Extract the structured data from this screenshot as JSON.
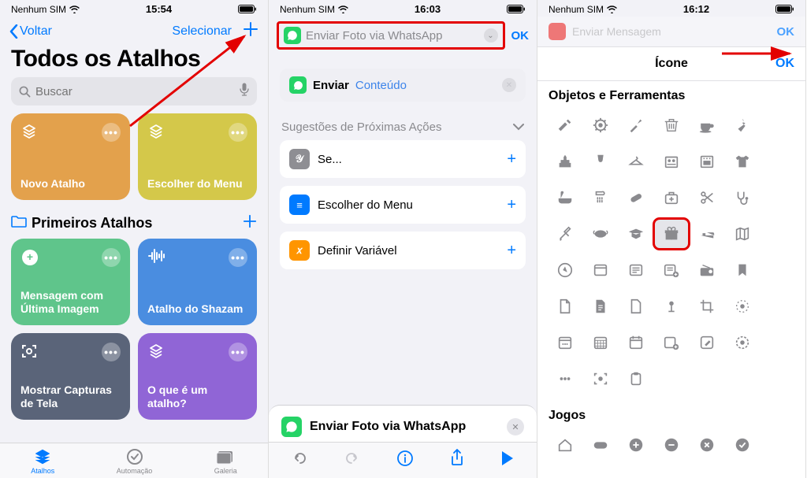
{
  "statusbar": {
    "carrier": "Nenhum SIM",
    "time1": "15:54",
    "time2": "16:03",
    "time3": "16:12"
  },
  "phone1": {
    "nav": {
      "back": "Voltar",
      "select": "Selecionar"
    },
    "title": "Todos os Atalhos",
    "search_placeholder": "Buscar",
    "cards": {
      "novo": "Novo Atalho",
      "escolher": "Escolher do Menu",
      "msg": "Mensagem com Última Imagem",
      "shazam": "Atalho do Shazam",
      "capturas": "Mostrar Capturas de Tela",
      "oque": "O que é um atalho?"
    },
    "section": "Primeiros Atalhos",
    "tabs": {
      "atalhos": "Atalhos",
      "auto": "Automação",
      "galeria": "Galeria"
    }
  },
  "phone2": {
    "name_placeholder": "Enviar Foto via WhatsApp",
    "ok": "OK",
    "action_label": "Enviar",
    "action_pill": "Conteúdo",
    "suggestions_header": "Sugestões de Próximas Ações",
    "suggestions": [
      {
        "label": "Se...",
        "iconClass": "si-gray",
        "glyph": "𝒴"
      },
      {
        "label": "Escolher do Menu",
        "iconClass": "si-blue",
        "glyph": "≡"
      },
      {
        "label": "Definir Variável",
        "iconClass": "si-orange",
        "glyph": "𝑥"
      }
    ],
    "sheet_title": "Enviar Foto via WhatsApp"
  },
  "phone3": {
    "blur_text": "Enviar Mensagem",
    "ok": "OK",
    "title": "Ícone",
    "section1": "Objetos e Ferramentas",
    "section2": "Jogos",
    "icons_row1": [
      "hammer",
      "gear",
      "screwdriver",
      "trash",
      "coffee",
      "carrot"
    ],
    "icons_row2": [
      "cake",
      "wine",
      "hanger",
      "stove-a",
      "stove-b",
      "tshirt"
    ],
    "icons_row3": [
      "bath",
      "shower",
      "pill",
      "medkit",
      "scissors",
      "steth"
    ],
    "icons_row4": [
      "syringe",
      "mask",
      "grad",
      "gift",
      "bed",
      "map"
    ],
    "icons_row5": [
      "compass",
      "window",
      "news",
      "newsplus",
      "radio",
      "bookmark"
    ],
    "icons_row6": [
      "doc",
      "docfill",
      "docblank",
      "pin",
      "crop",
      "cog"
    ],
    "icons_row7": [
      "date",
      "datedots",
      "cal",
      "calplus",
      "edit",
      "dot"
    ],
    "icons_row8": [
      "dots",
      "scan",
      "clip",
      "",
      "",
      ""
    ],
    "games_row": [
      "house",
      "gamepad",
      "plus",
      "minus",
      "xmark",
      "check"
    ]
  }
}
